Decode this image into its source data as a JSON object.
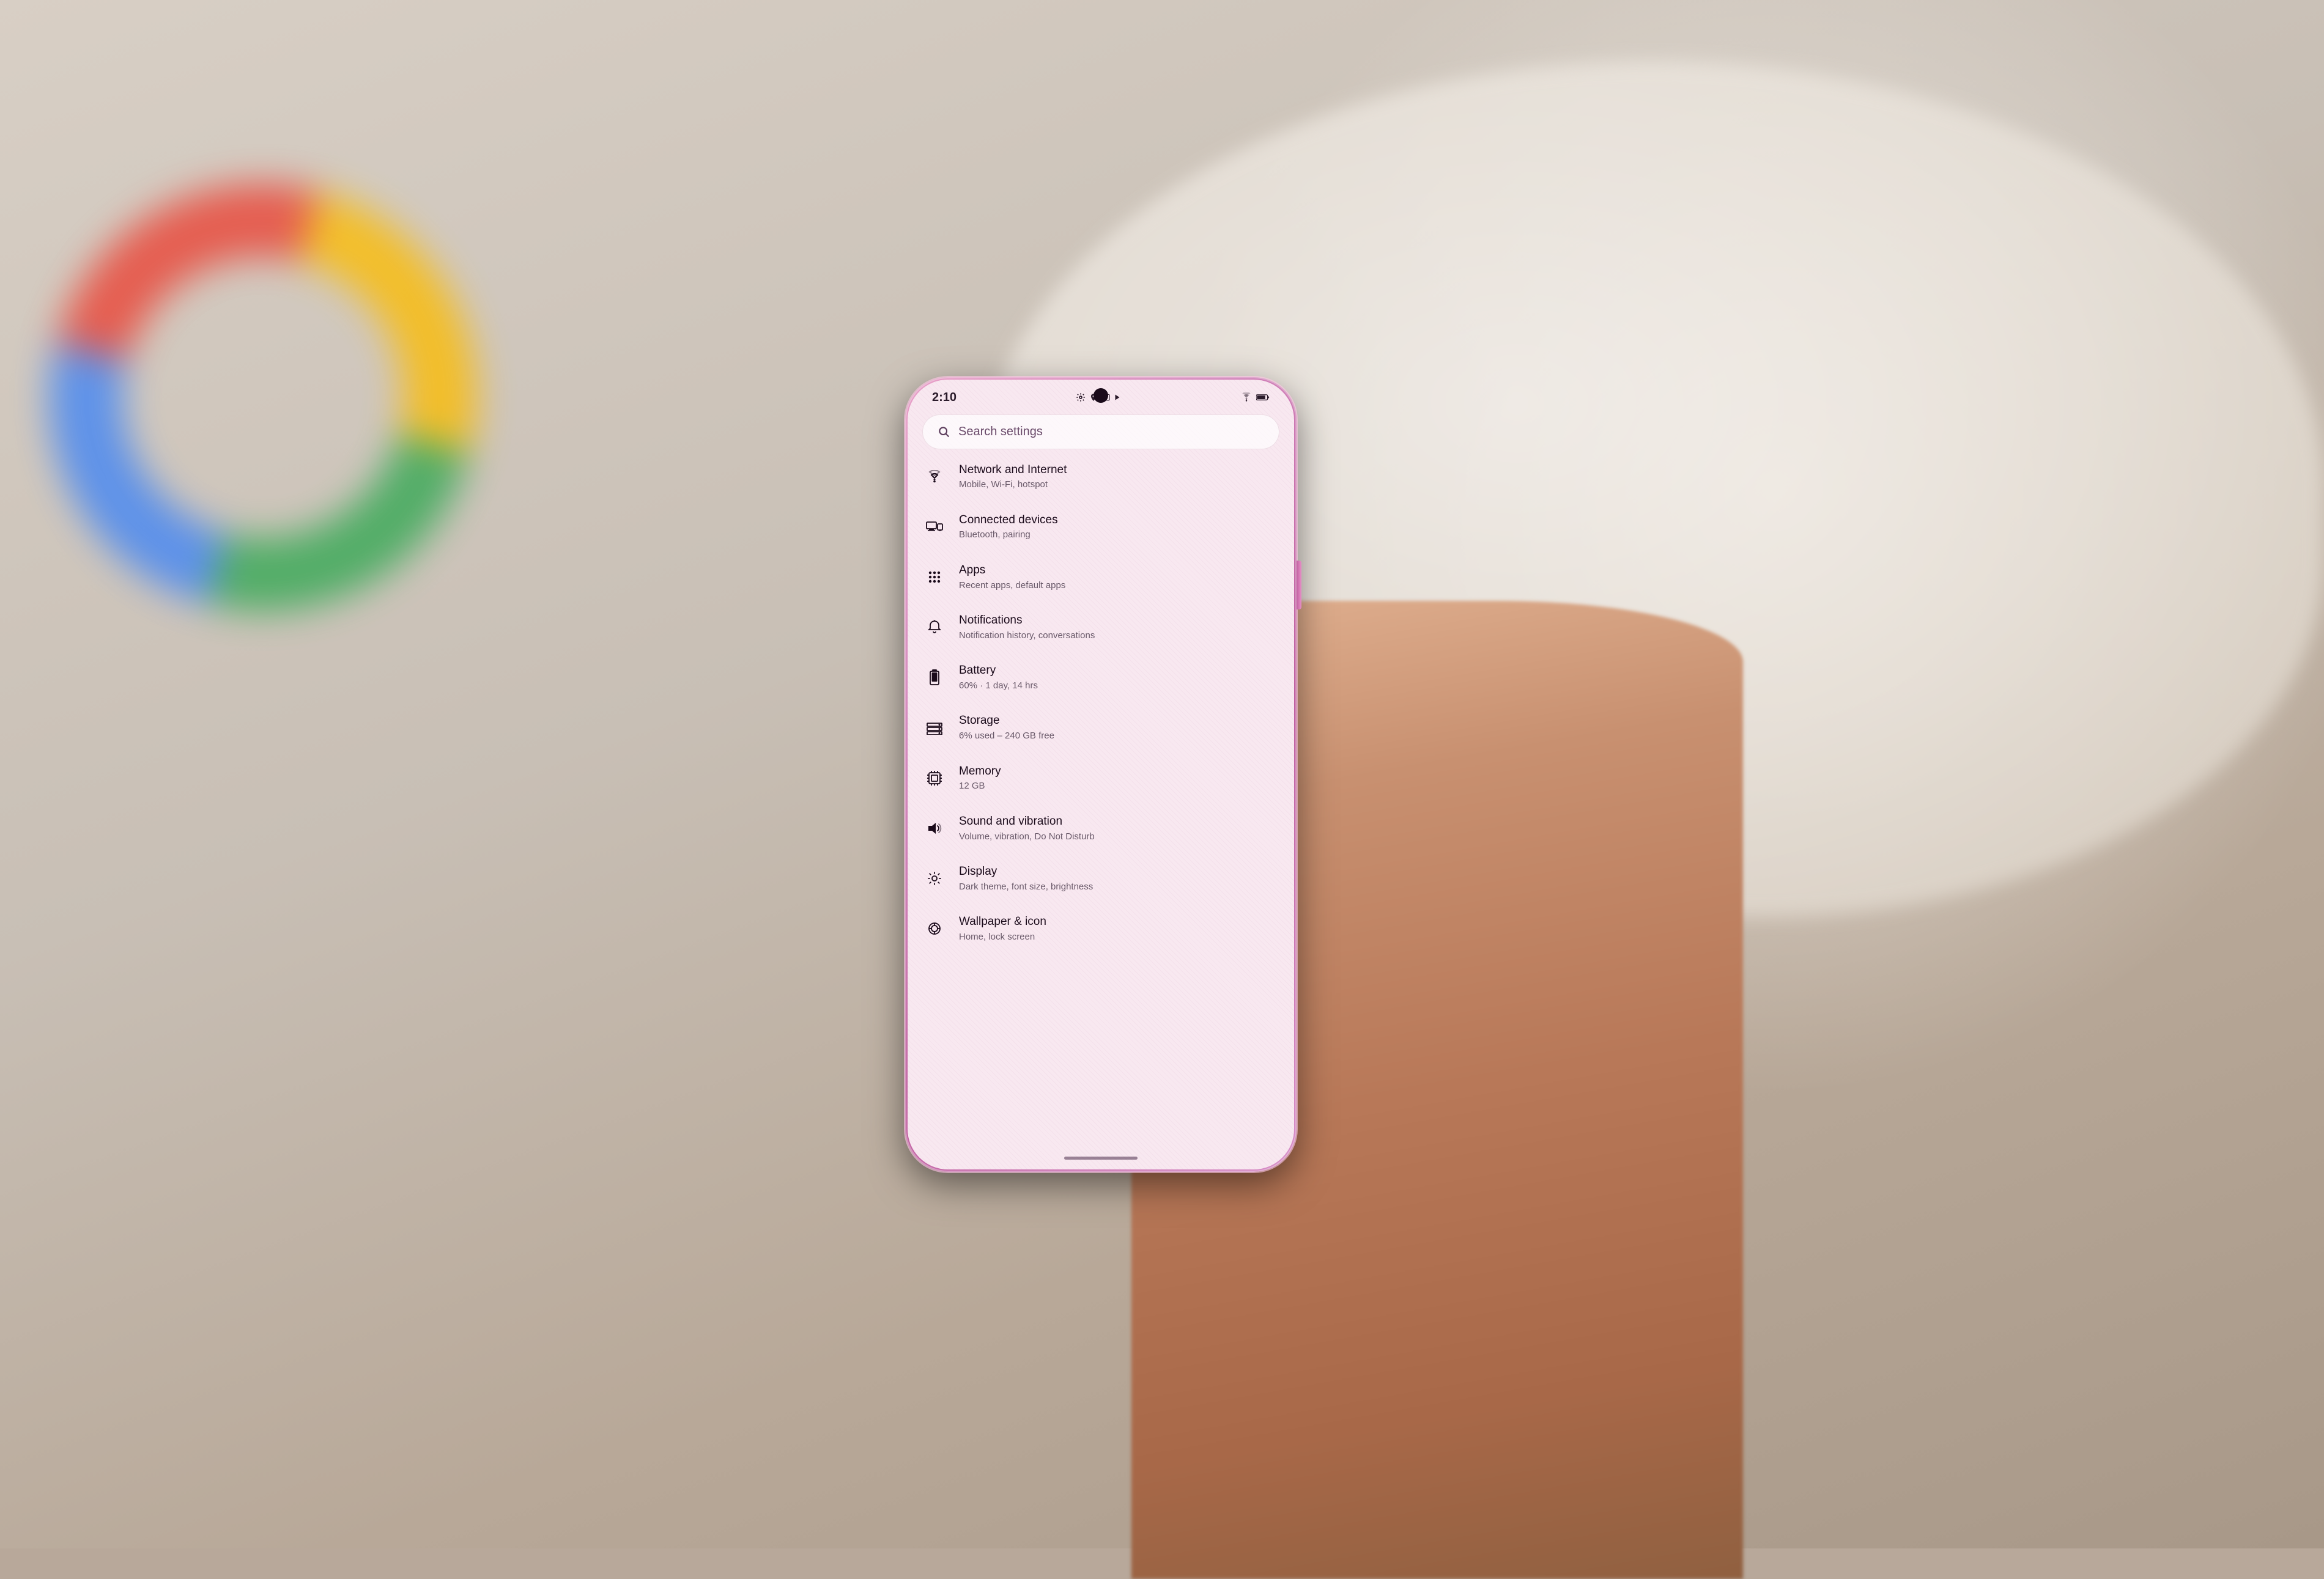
{
  "background": {
    "description": "Hand holding pink Android phone with settings screen"
  },
  "statusBar": {
    "time": "2:10",
    "icons": [
      "settings-icon",
      "location-icon",
      "cast-icon",
      "play-icon"
    ],
    "wifi": "wifi",
    "battery": "battery"
  },
  "search": {
    "placeholder": "Search settings"
  },
  "settings": {
    "items": [
      {
        "id": "network",
        "icon": "wifi-icon",
        "title": "Network and Internet",
        "subtitle": "Mobile, Wi-Fi, hotspot"
      },
      {
        "id": "connected-devices",
        "icon": "devices-icon",
        "title": "Connected devices",
        "subtitle": "Bluetooth, pairing"
      },
      {
        "id": "apps",
        "icon": "apps-icon",
        "title": "Apps",
        "subtitle": "Recent apps, default apps"
      },
      {
        "id": "notifications",
        "icon": "bell-icon",
        "title": "Notifications",
        "subtitle": "Notification history, conversations"
      },
      {
        "id": "battery",
        "icon": "battery-icon",
        "title": "Battery",
        "subtitle": "60% · 1 day, 14 hrs"
      },
      {
        "id": "storage",
        "icon": "storage-icon",
        "title": "Storage",
        "subtitle": "6% used – 240 GB free"
      },
      {
        "id": "memory",
        "icon": "memory-icon",
        "title": "Memory",
        "subtitle": "12 GB"
      },
      {
        "id": "sound",
        "icon": "sound-icon",
        "title": "Sound and vibration",
        "subtitle": "Volume, vibration, Do Not Disturb"
      },
      {
        "id": "display",
        "icon": "display-icon",
        "title": "Display",
        "subtitle": "Dark theme, font size, brightness"
      },
      {
        "id": "wallpaper",
        "icon": "wallpaper-icon",
        "title": "Wallpaper & icon",
        "subtitle": "Home, lock screen"
      }
    ]
  }
}
